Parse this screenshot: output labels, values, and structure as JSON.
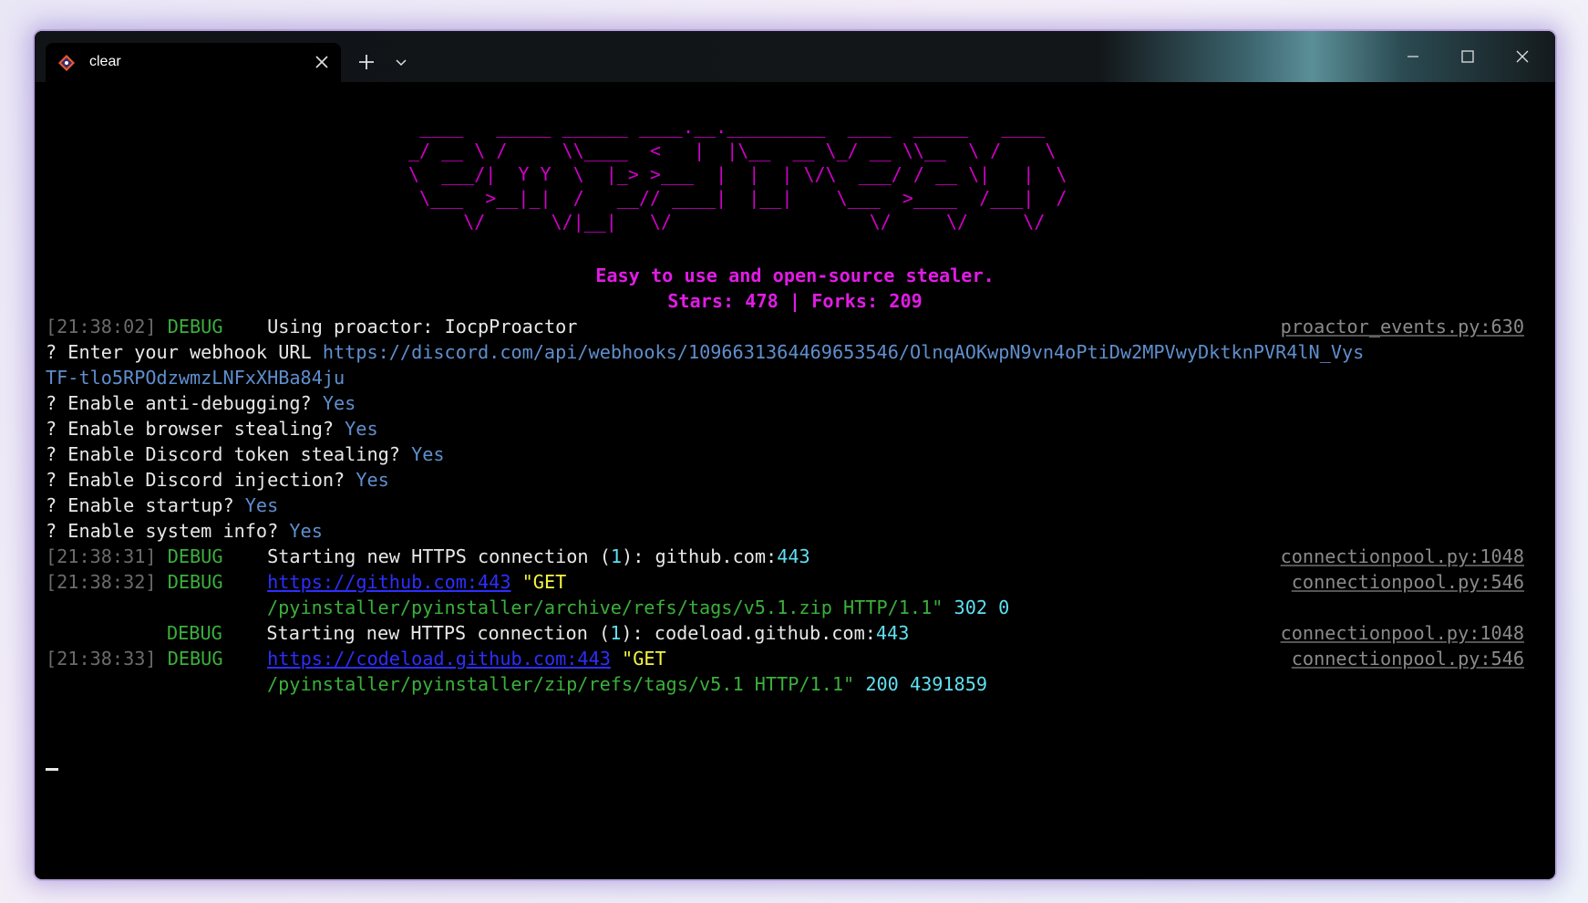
{
  "tab": {
    "title": "clear",
    "icon": "git-bash-icon"
  },
  "banner": {
    "ascii": [
      " ____   _____ ______ ____.__._________  ____  _____   ____ ",
      "_/ __ \\ /     \\\\____  <   |  |\\__  __ \\_/ __ \\\\__  \\ /    \\",
      "\\  ___/|  Y Y  \\  |_> >___  |  |  | \\/\\  ___/ / __ \\|   |  \\",
      " \\___  >__|_|  /   __// ____|  |__|    \\___  >____  /___|  /",
      "     \\/      \\/|__|   \\/                  \\/     \\/     \\/ "
    ],
    "tagline": "Easy to use and open-source stealer.",
    "stats": "Stars: 478 | Forks: 209"
  },
  "log": {
    "l1": {
      "ts": "[21:38:02]",
      "level": "DEBUG",
      "msg": "Using proactor: IocpProactor",
      "src": "proactor_events.py:630"
    },
    "webhook": {
      "prompt": "? Enter your webhook URL ",
      "url1": "https://discord.com/api/webhooks/1096631364469653546/OlnqAOKwpN9vn4oPtiDw2MPVwyDktknPVR4lN_Vys",
      "url2": "TF-tlo5RPOdzwmzLNFxXHBa84ju"
    },
    "questions": [
      {
        "q": "? Enable anti-debugging? ",
        "a": "Yes"
      },
      {
        "q": "? Enable browser stealing? ",
        "a": "Yes"
      },
      {
        "q": "? Enable Discord token stealing? ",
        "a": "Yes"
      },
      {
        "q": "? Enable Discord injection? ",
        "a": "Yes"
      },
      {
        "q": "? Enable startup? ",
        "a": "Yes"
      },
      {
        "q": "? Enable system info? ",
        "a": "Yes"
      }
    ],
    "l2": {
      "ts": "[21:38:31]",
      "level": "DEBUG",
      "msg_a": "Starting new HTTPS connection (",
      "n": "1",
      "msg_b": "): github.com:",
      "port": "443",
      "src": "connectionpool.py:1048"
    },
    "l3": {
      "ts": "[21:38:32]",
      "level": "DEBUG",
      "link": "https://github.com:443",
      "get": " \"GET",
      "path": "/pyinstaller/pyinstaller/archive/refs/tags/v5.1.zip HTTP/1.1\"",
      "status": " 302 0",
      "src": "connectionpool.py:546"
    },
    "l4": {
      "level": "DEBUG",
      "msg_a": "Starting new HTTPS connection (",
      "n": "1",
      "msg_b": "): codeload.github.com:",
      "port": "443",
      "src": "connectionpool.py:1048"
    },
    "l5": {
      "ts": "[21:38:33]",
      "level": "DEBUG",
      "link": "https://codeload.github.com:443",
      "get": " \"GET",
      "path": "/pyinstaller/pyinstaller/zip/refs/tags/v5.1 HTTP/1.1\"",
      "status": " 200 4391859",
      "src": "connectionpool.py:546"
    }
  }
}
